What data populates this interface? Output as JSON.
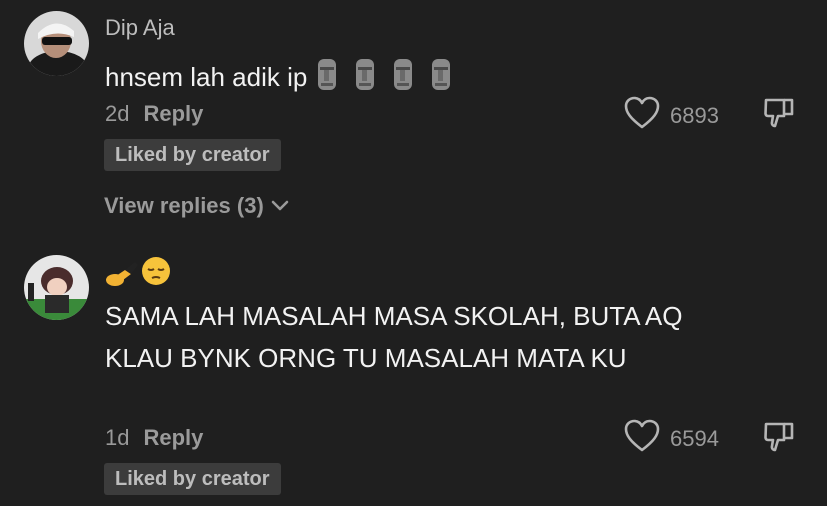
{
  "comments": [
    {
      "username": "Dip Aja",
      "text": "hnsem lah adik ip",
      "emoji": [
        "moai-icon",
        "moai-icon",
        "moai-icon",
        "moai-icon"
      ],
      "time": "2d",
      "reply_label": "Reply",
      "likes": "6893",
      "badge": "Liked by creator",
      "view_replies": "View replies (3)"
    },
    {
      "username": "",
      "emoji": [
        "writing-hand-icon",
        "pensive-face-icon"
      ],
      "text": "SAMA LAH MASALAH MASA SKOLAH, BUTA AQ KLAU BYNK ORNG TU MASALAH MATA KU",
      "time": "1d",
      "reply_label": "Reply",
      "likes": "6594",
      "badge": "Liked by creator"
    }
  ],
  "colors": {
    "background": "#1f1f1f",
    "text": "#f2f2f2",
    "muted": "#9a9a9a",
    "badge_bg": "#3c3c3c"
  }
}
